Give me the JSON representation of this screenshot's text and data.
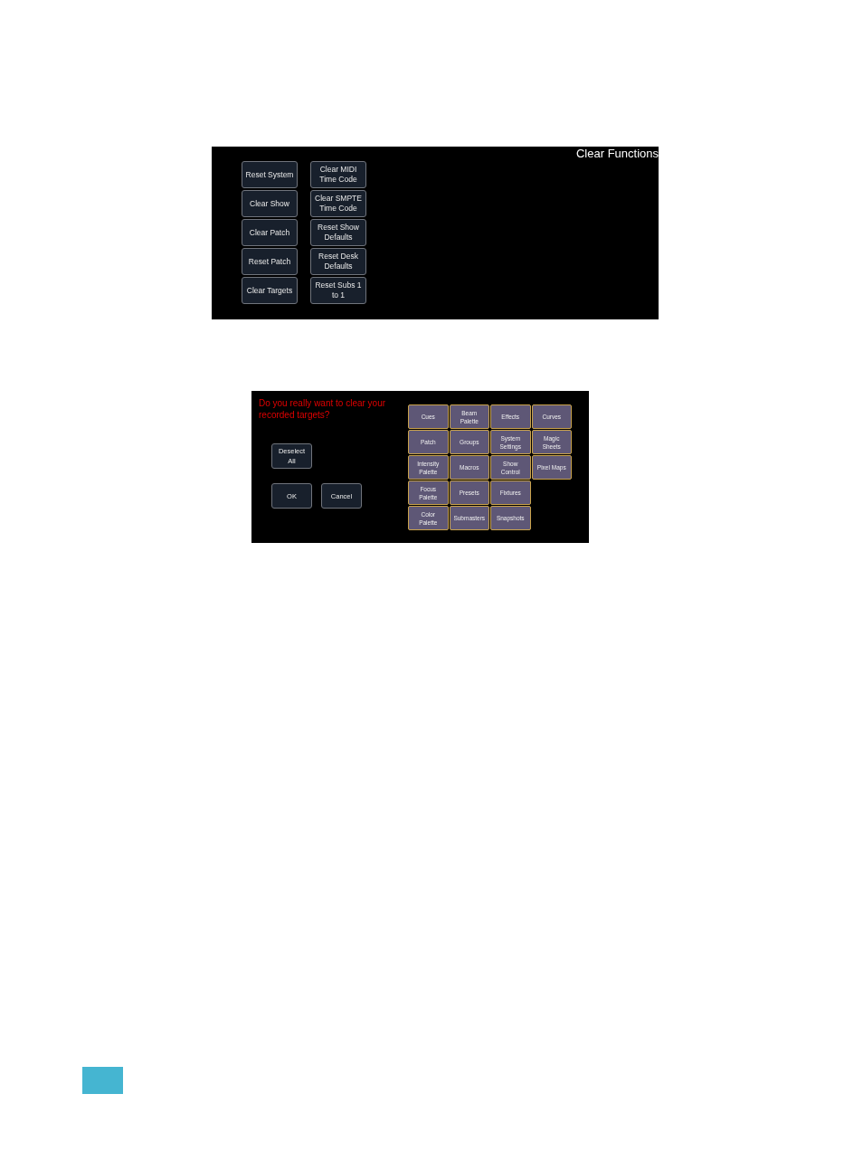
{
  "clear_functions": {
    "title": "Clear Functions",
    "columns": [
      [
        "Reset System",
        "Clear Show",
        "Clear Patch",
        "Reset Patch",
        "Clear Targets"
      ],
      [
        "Clear MIDI\nTime Code",
        "Clear SMPTE\nTime Code",
        "Reset Show\nDefaults",
        "Reset Desk\nDefaults",
        "Reset Subs 1\nto 1"
      ]
    ]
  },
  "clear_targets": {
    "prompt": "Do you really want to clear your\nrecorded targets?",
    "deselect_button": "Deselect\nAll",
    "actions": [
      "OK",
      "Cancel"
    ],
    "targets": [
      [
        "Cues",
        "Beam\nPalette",
        "Effects",
        "Curves"
      ],
      [
        "Patch",
        "Groups",
        "System\nSettings",
        "Magic\nSheets"
      ],
      [
        "Intensity\nPalette",
        "Macros",
        "Show\nControl",
        "Pixel Maps"
      ],
      [
        "Focus\nPalette",
        "Presets",
        "Fixtures"
      ],
      [
        "Color\nPalette",
        "Submasters",
        "Snapshots"
      ]
    ]
  }
}
